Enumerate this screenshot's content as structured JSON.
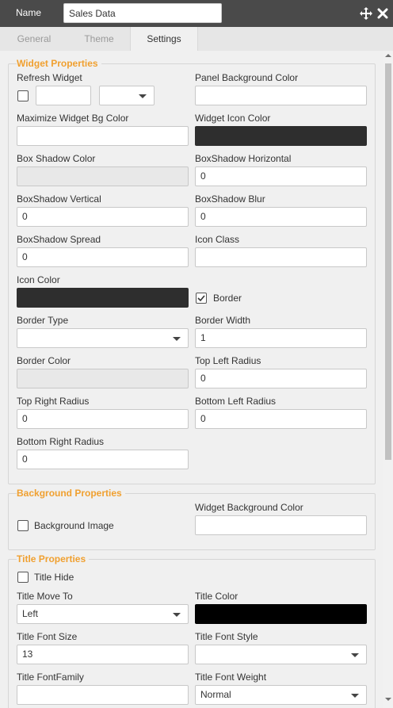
{
  "header": {
    "name_label": "Name",
    "name_value": "Sales Data",
    "move_icon": "move-icon",
    "close_icon": "close-icon"
  },
  "tabs": [
    {
      "label": "General",
      "active": false
    },
    {
      "label": "Theme",
      "active": false
    },
    {
      "label": "Settings",
      "active": true
    }
  ],
  "widget_properties": {
    "legend": "Widget Properties",
    "refresh_widget": {
      "label": "Refresh Widget",
      "checked": false,
      "value": "",
      "unit": ""
    },
    "panel_bg_color": {
      "label": "Panel Background Color",
      "value": ""
    },
    "maximize_bg_color": {
      "label": "Maximize Widget Bg Color",
      "value": ""
    },
    "widget_icon_color": {
      "label": "Widget Icon Color",
      "color": "#2e2e2e"
    },
    "box_shadow_color": {
      "label": "Box Shadow Color",
      "value": ""
    },
    "boxshadow_horizontal": {
      "label": "BoxShadow Horizontal",
      "value": "0"
    },
    "boxshadow_vertical": {
      "label": "BoxShadow Vertical",
      "value": "0"
    },
    "boxshadow_blur": {
      "label": "BoxShadow Blur",
      "value": "0"
    },
    "boxshadow_spread": {
      "label": "BoxShadow Spread",
      "value": "0"
    },
    "icon_class": {
      "label": "Icon Class",
      "value": ""
    },
    "icon_color": {
      "label": "Icon Color",
      "color": "#2e2e2e"
    },
    "border": {
      "label": "Border",
      "checked": true
    },
    "border_type": {
      "label": "Border Type",
      "value": ""
    },
    "border_width": {
      "label": "Border Width",
      "value": "1"
    },
    "border_color": {
      "label": "Border Color",
      "value": ""
    },
    "top_left_radius": {
      "label": "Top Left Radius",
      "value": "0"
    },
    "top_right_radius": {
      "label": "Top Right Radius",
      "value": "0"
    },
    "bottom_left_radius": {
      "label": "Bottom Left Radius",
      "value": "0"
    },
    "bottom_right_radius": {
      "label": "Bottom Right Radius",
      "value": "0"
    }
  },
  "background_properties": {
    "legend": "Background Properties",
    "background_image": {
      "label": "Background Image",
      "checked": false
    },
    "widget_bg_color": {
      "label": "Widget Background Color",
      "value": ""
    }
  },
  "title_properties": {
    "legend": "Title Properties",
    "title_hide": {
      "label": "Title Hide",
      "checked": false
    },
    "title_move_to": {
      "label": "Title Move To",
      "value": "Left"
    },
    "title_color": {
      "label": "Title Color",
      "color": "#000000"
    },
    "title_font_size": {
      "label": "Title Font Size",
      "value": "13"
    },
    "title_font_style": {
      "label": "Title Font Style",
      "value": ""
    },
    "title_font_family": {
      "label": "Title FontFamily",
      "value": ""
    },
    "title_font_weight": {
      "label": "Title Font Weight",
      "value": "Normal"
    }
  },
  "colors": {
    "header_bg": "#4a4a4a",
    "legend": "#f0a030",
    "panel_bg": "#f0f0f0"
  }
}
